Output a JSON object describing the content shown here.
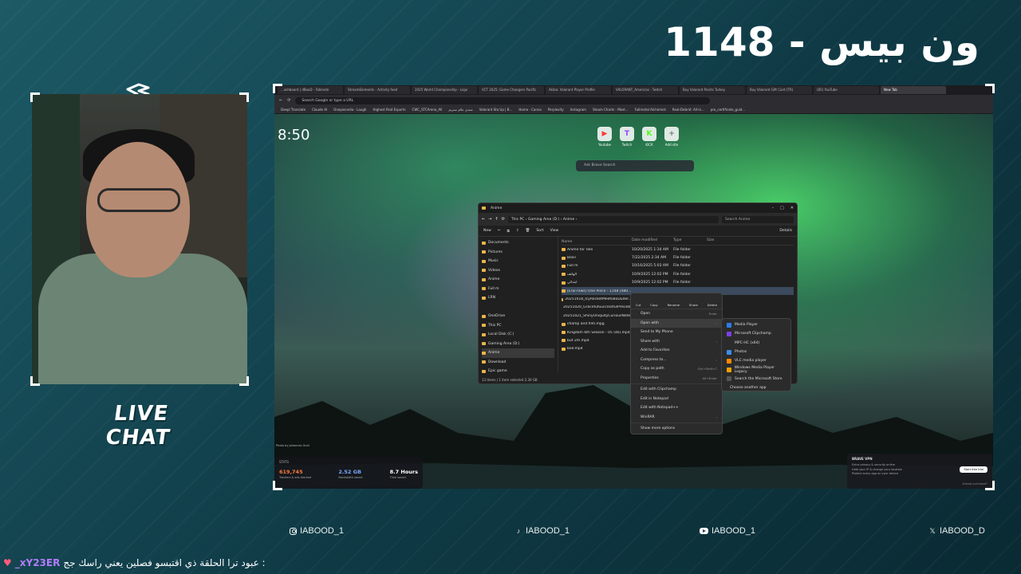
{
  "stream": {
    "title": "ون بيس - 1148",
    "live_chat_label": "LIVE CHAT"
  },
  "browser": {
    "tabs": [
      "...ashboard | dBoaD - Fallende",
      "StreamElements - Activity feed",
      "2025 World Championship - Liqui",
      "VCT 2025: Game Changers Pacific",
      "Akiba: Valorant Player Profile",
      "VALORANT_Americas - Twitch",
      "Buy Valorant Points Turkey",
      "Buy Valorant Gift Card (TR)",
      "(85) YouTube",
      "New Tab"
    ],
    "address_placeholder": "Search Google or type a URL",
    "bookmarks": [
      "Deepl Translate",
      "Claude AI",
      "Onepiecedia - Laugh",
      "Highest Paid Esports",
      "CWC_STCArena_All",
      "منتدى عالم ستريم",
      "Valorant Sta Up | B...",
      "Home - Canva",
      "Perplexity",
      "Instagram",
      "Steam Charts - Most...",
      "Fullmetal Alchemist",
      "Real-Debrid: All-in...",
      "pro_certificate_guid..."
    ],
    "clock": "8:50",
    "speed_dial": [
      {
        "label": "Youtube",
        "glyph": "▶",
        "color": "#ff3b3b"
      },
      {
        "label": "Twitch",
        "glyph": "T",
        "color": "#9146ff"
      },
      {
        "label": "KICK",
        "glyph": "K",
        "color": "#53fc18"
      },
      {
        "label": "Add site",
        "glyph": "+",
        "color": "#777777"
      }
    ],
    "newtab_search_placeholder": "Ask Brave Search",
    "photo_credit": "Photo by Johannes Groll"
  },
  "explorer": {
    "title": "Anime",
    "breadcrumb": "This PC  ›  Gaming Area (D:)  ›  Anime  ›",
    "search_placeholder": "Search Anime",
    "toolbar": [
      "New",
      "Sort",
      "View",
      "Details"
    ],
    "sidebar": [
      "Documents",
      "Pictures",
      "Music",
      "Videos",
      "Anime",
      "Full m",
      "LRN",
      "",
      "OneDrive",
      "This PC",
      "Local Disk (C:)",
      "Gaming Area (D:)",
      "Anime",
      "Download",
      "Epic game"
    ],
    "columns": [
      "Name",
      "Date modified",
      "Type",
      "Size"
    ],
    "files": [
      {
        "name": "Anime for Tele",
        "date": "10/20/2025 1:34 AM",
        "type": "File folder"
      },
      {
        "name": "Basil",
        "date": "7/22/2025 2:34 AM",
        "type": "File folder"
      },
      {
        "name": "Full m",
        "date": "10/16/2025 5:03 AM",
        "type": "File folder"
      },
      {
        "name": "الهاتف",
        "date": "10/9/2025 12:02 PM",
        "type": "File folder"
      },
      {
        "name": "ابتدائي",
        "date": "10/9/2025 12:02 PM",
        "type": "File folder"
      },
      {
        "name": "[Erai-raws] One Piece - 1148 [480...",
        "date": "",
        "type": ""
      },
      {
        "name": "20251018_IcyRocketMeetsBoDuder...",
        "date": "",
        "type": ""
      },
      {
        "name": "20251020_GracefulSuccessfulPresident...",
        "date": "",
        "type": ""
      },
      {
        "name": "20251021_ShinyUniquityCuriousNoteMay...",
        "date": "",
        "type": ""
      },
      {
        "name": "champ and film.mpg",
        "date": "",
        "type": ""
      },
      {
        "name": "Kingdom 6th Season - 05 (4k).mp4",
        "date": "",
        "type": ""
      },
      {
        "name": "but 2m.mp4",
        "date": "",
        "type": ""
      },
      {
        "name": "ball.mp4",
        "date": "",
        "type": ""
      }
    ],
    "status": "13 items   |   1 item selected  2.30 GB"
  },
  "context_menu": {
    "actions": [
      "Cut",
      "Copy",
      "Rename",
      "Share",
      "Delete"
    ],
    "items": [
      {
        "label": "Open",
        "shortcut": "Enter"
      },
      {
        "label": "Open with",
        "shortcut": "›"
      },
      {
        "label": "Send to My Phone",
        "shortcut": ""
      },
      {
        "label": "Share with",
        "shortcut": "›"
      },
      {
        "label": "Add to Favorites",
        "shortcut": ""
      },
      {
        "label": "Compress to...",
        "shortcut": "›"
      },
      {
        "label": "Copy as path",
        "shortcut": "Ctrl+Shift+C"
      },
      {
        "label": "Properties",
        "shortcut": "Alt+Enter"
      },
      {
        "label": "Edit with Clipchamp",
        "shortcut": ""
      },
      {
        "label": "Edit in Notepad",
        "shortcut": ""
      },
      {
        "label": "Edit with Notepad++",
        "shortcut": ""
      },
      {
        "label": "WinRAR",
        "shortcut": "›"
      },
      {
        "label": "Show more options",
        "shortcut": ""
      }
    ],
    "open_with": [
      {
        "label": "Media Player",
        "color": "#2b7de9"
      },
      {
        "label": "Microsoft Clipchamp",
        "color": "#7b3fe4"
      },
      {
        "label": "MPC-HC (x64)",
        "color": "#2a2a2a"
      },
      {
        "label": "Photos",
        "color": "#3b8eea"
      },
      {
        "label": "VLC media player",
        "color": "#ff8800"
      },
      {
        "label": "Windows Media Player Legacy",
        "color": "#f0a000"
      },
      {
        "label": "Search the Microsoft Store",
        "color": "#555555"
      },
      {
        "label": "Choose another app",
        "color": ""
      }
    ]
  },
  "stats_widget": {
    "title": "STATS",
    "items": [
      {
        "value": "619,745",
        "label": "Trackers & ads blocked",
        "color": "#ff7a3d"
      },
      {
        "value": "2.52 GB",
        "label": "Bandwidth saved",
        "color": "#7aa7ff"
      },
      {
        "value": "8.7 Hours",
        "label": "Time saved",
        "color": "#ffffff"
      }
    ]
  },
  "vpn_widget": {
    "title": "BRAVE VPN",
    "lines": [
      "Extra privacy & security online",
      "Hide your IP & change your location",
      "Protect every app on your device"
    ],
    "button": "Start free trial",
    "footer": "Already purchased?"
  },
  "socials": [
    {
      "icon": "instagram-icon",
      "handle": "IABOOD_1"
    },
    {
      "icon": "tiktok-icon",
      "handle": "IABOOD_1"
    },
    {
      "icon": "youtube-icon",
      "handle": "IABOOD_1"
    },
    {
      "icon": "x-icon",
      "handle": "IABOOD_D"
    }
  ],
  "chat": {
    "user": "_xY23ER",
    "message": "عبود ترا الحلقة ذي اقتبسو فصلين يعني راسك جج :"
  }
}
